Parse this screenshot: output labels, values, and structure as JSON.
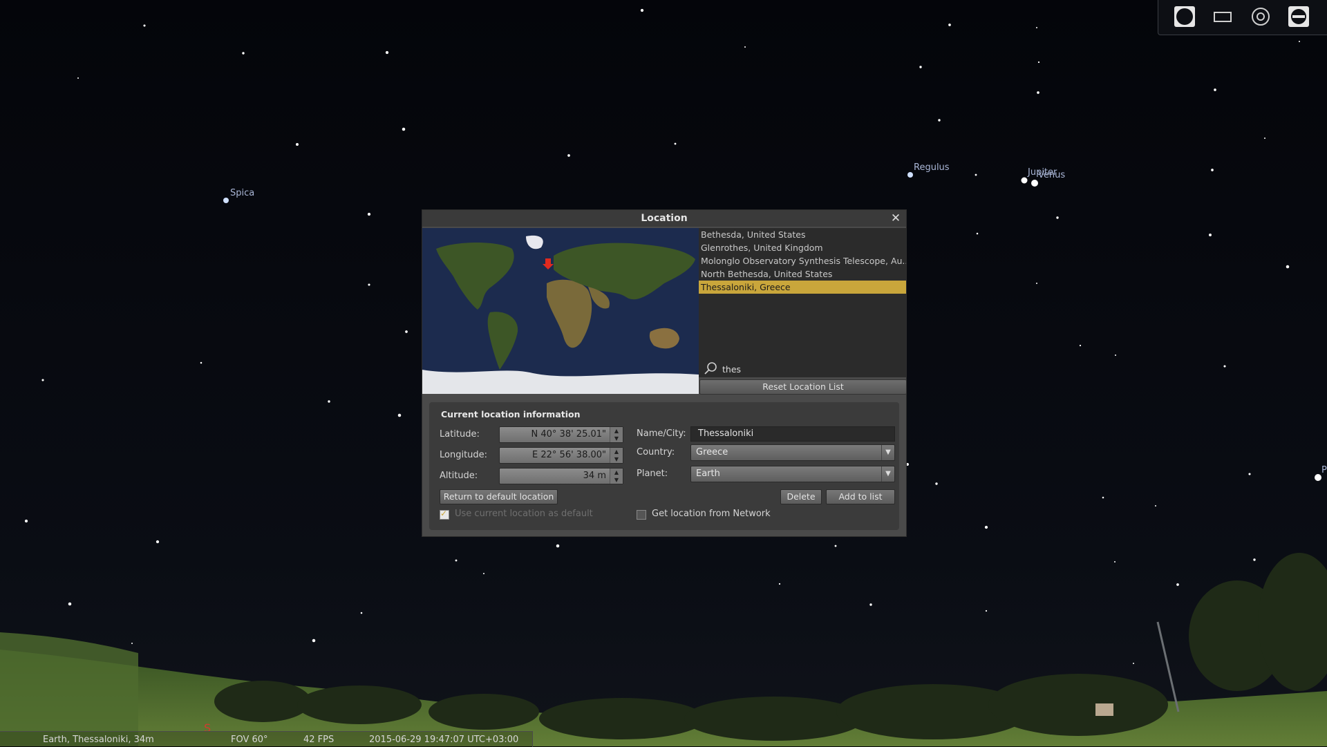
{
  "sky": {
    "labels": {
      "spica": "Spica",
      "regulus": "Regulus",
      "jupiter": "Jupiter",
      "venus": "Venus",
      "edge": "P"
    }
  },
  "toolbar": {
    "icons": [
      "night-mode-icon",
      "fullscreen-icon",
      "target-icon",
      "quit-icon"
    ]
  },
  "status": {
    "location": "Earth, Thessaloniki, 34m",
    "fov": "FOV 60°",
    "fps": "42 FPS",
    "datetime": "2015-06-29   19:47:07 UTC+03:00"
  },
  "compass": {
    "label": "S",
    "color": "#d23a2f"
  },
  "dialog": {
    "title": "Location",
    "locations": [
      "Bethesda, United States",
      "Glenrothes, United Kingdom",
      "Molonglo Observatory Synthesis Telescope, Au...",
      "North Bethesda, United States",
      "Thessaloniki, Greece"
    ],
    "selected_index": 4,
    "search_value": "thes",
    "reset_button": "Reset Location List",
    "info": {
      "title": "Current location information",
      "latitude_label": "Latitude:",
      "latitude_value": "N 40° 38' 25.01\"",
      "longitude_label": "Longitude:",
      "longitude_value": "E 22° 56' 38.00\"",
      "altitude_label": "Altitude:",
      "altitude_value": "34 m",
      "name_label": "Name/City:",
      "name_value": "Thessaloniki",
      "country_label": "Country:",
      "country_value": "Greece",
      "planet_label": "Planet:",
      "planet_value": "Earth",
      "return_button": "Return to default location",
      "delete_button": "Delete",
      "add_button": "Add to list",
      "use_default_label": "Use current location as default",
      "use_default_checked": true,
      "network_label": "Get location from Network",
      "network_checked": false
    }
  },
  "colors": {
    "accent": "#c9a63b",
    "panel": "#4a4a4a",
    "star_label": "#a9b6d6"
  }
}
